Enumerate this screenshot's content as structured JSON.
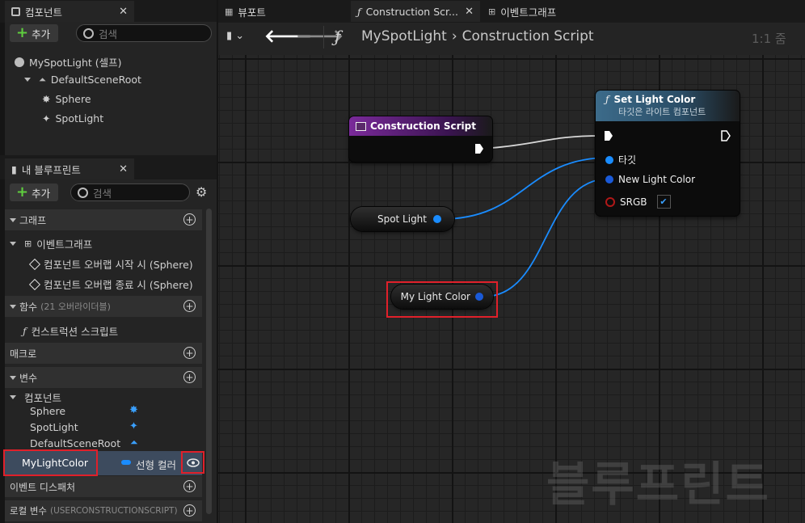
{
  "components_panel": {
    "tab_title": "컴포넌트",
    "add_label": "추가",
    "search_placeholder": "검색",
    "tree": {
      "root": "MySpotLight (셀프)",
      "scene_root": "DefaultSceneRoot",
      "children": [
        "Sphere",
        "SpotLight"
      ]
    }
  },
  "my_blueprint_panel": {
    "tab_title": "내 블루프린트",
    "add_label": "추가",
    "search_placeholder": "검색",
    "graphs": {
      "header": "그래프",
      "event_graph": "이벤트그래프",
      "events": [
        "컴포넌트 오버랩 시작 시 (Sphere)",
        "컴포넌트 오버랩 종료 시 (Sphere)"
      ]
    },
    "functions": {
      "header": "함수",
      "override_note": "(21 오버라이더블)",
      "items": [
        "컨스트럭션 스크립트"
      ]
    },
    "macros_header": "매크로",
    "variables": {
      "header": "변수",
      "components_group": "컴포넌트",
      "components": [
        "Sphere",
        "SpotLight",
        "DefaultSceneRoot"
      ],
      "selected_var": {
        "name": "MyLightColor",
        "type": "선형 컬러"
      }
    },
    "dispatchers_header": "이벤트 디스패처",
    "local_vars_header": "로컬 변수",
    "local_vars_note": "(USERCONSTRUCTIONSCRIPT)"
  },
  "editor_tabs": [
    "뷰포트",
    "Construction Scr...",
    "이벤트그래프"
  ],
  "toolbar": {
    "breadcrumb_blueprint": "MySpotLight",
    "breadcrumb_graph": "Construction Script",
    "zoom": "1:1 줌"
  },
  "graph": {
    "construction_node_title": "Construction Script",
    "set_light_node": {
      "title": "Set Light Color",
      "subtitle": "타깃은 라이트 컴포넌트",
      "pin_target": "타깃",
      "pin_color": "New Light Color",
      "pin_srgb": "SRGB",
      "srgb_checked": true
    },
    "spot_light_var": "Spot Light",
    "my_light_color_var": "My Light Color",
    "watermark": "블루프린트"
  },
  "colors": {
    "pin_blue": "#1a8cff",
    "highlight_red": "#e0202a",
    "func_header_blue": "#3c6b8a",
    "event_header_purple": "#7a2a9a"
  }
}
